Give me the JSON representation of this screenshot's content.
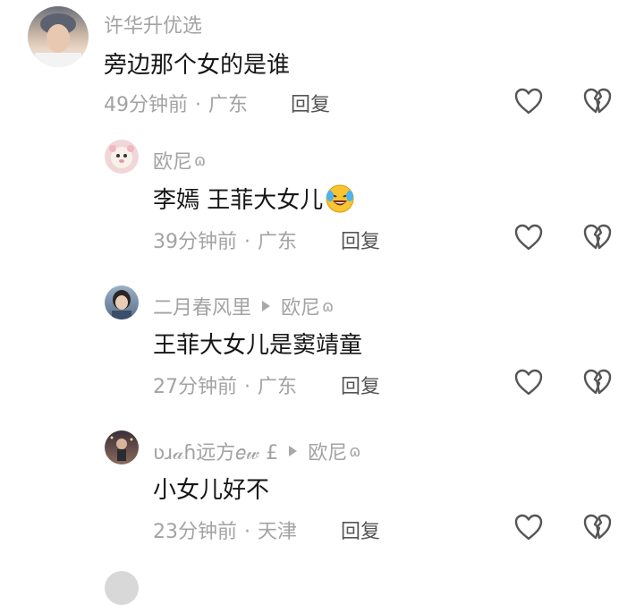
{
  "comments": [
    {
      "username": "许华升优选",
      "text": "旁边那个女的是谁",
      "time": "49分钟前",
      "location": "广东",
      "reply_label": "回复"
    },
    {
      "username": "欧尼",
      "username_suffix": "ɷ",
      "text": "李嫣 王菲大女儿",
      "text_emoji": "laughing-crying-emoji",
      "time": "39分钟前",
      "location": "广东",
      "reply_label": "回复"
    },
    {
      "username": "二月春风里",
      "reply_to": "欧尼",
      "reply_to_suffix": "ɷ",
      "text": "王菲大女儿是窦靖童",
      "time": "27分钟前",
      "location": "广东",
      "reply_label": "回复"
    },
    {
      "username": "ʋɹ𝒶ɦ远方𝑒𝓌 £",
      "reply_to": "欧尼",
      "reply_to_suffix": "ɷ",
      "text": "小女儿好不",
      "time": "23分钟前",
      "location": "天津",
      "reply_label": "回复"
    }
  ],
  "icons": {
    "like": "heart-outline-icon",
    "dislike": "broken-heart-icon",
    "reply_arrow": "triangle-right-icon"
  },
  "colors": {
    "muted_text": "#a3a3a3",
    "main_text": "#161616",
    "icon_stroke": "#555555"
  }
}
